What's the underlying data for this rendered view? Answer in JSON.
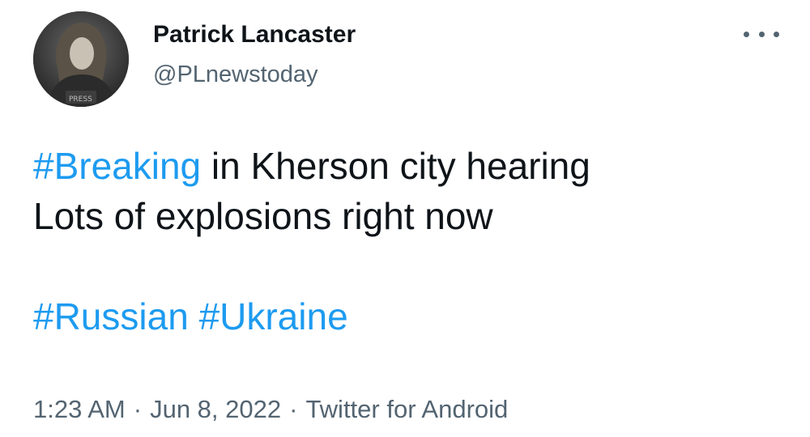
{
  "author": {
    "display_name": "Patrick Lancaster",
    "handle": "@PLnewstoday",
    "avatar_icon": "profile-photo"
  },
  "more_icon": "more-horizontal-icon",
  "tweet": {
    "line1": {
      "hashtag": "#Breaking",
      "text": " in Kherson city hearing"
    },
    "line2": "Lots of explosions right now",
    "hashtags": [
      "#Russian",
      "#Ukraine"
    ]
  },
  "meta": {
    "time": "1:23 AM",
    "separator": "·",
    "date": "Jun 8, 2022",
    "source": "Twitter for Android"
  },
  "colors": {
    "hashtag": "#1d9bf0",
    "text": "#0f1419",
    "secondary": "#536471"
  }
}
